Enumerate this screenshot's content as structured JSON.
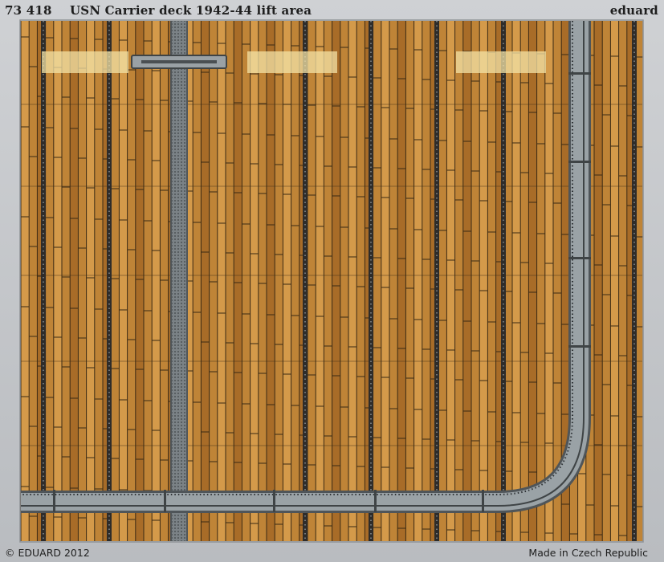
{
  "header": {
    "code": "73 418",
    "title": "USN Carrier deck 1942-44 lift area",
    "brand": "eduard"
  },
  "footer": {
    "copyright": "© EDUARD 2012",
    "origin": "Made in Czech Republic"
  },
  "colors": {
    "wood_light": "#d49a4a",
    "wood_mid": "#bf8437",
    "wood_dark": "#a86c28",
    "seam": "#3a2a14",
    "tiedown_strip": "#2e2c2a",
    "steel": "#8f979c",
    "steel_dark": "#4f5559",
    "highlight_patch": "#f3e2a6",
    "fret_frame": "#c6c8cb"
  }
}
